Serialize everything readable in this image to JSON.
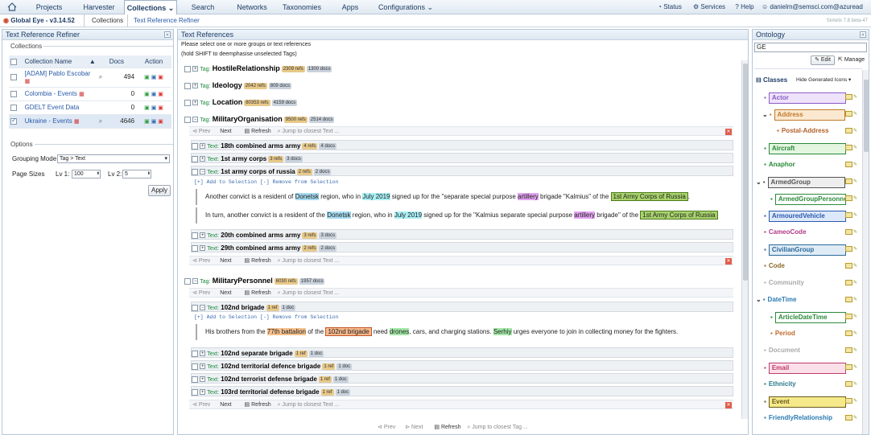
{
  "nav": {
    "home_icon": "home-icon",
    "items": [
      "Projects",
      "Harvester",
      "Collections",
      "Search",
      "Networks",
      "Taxonomies",
      "Apps",
      "Configurations"
    ],
    "right": {
      "status": "Status",
      "services": "Services",
      "help": "Help",
      "user": "danielm@semsci.com@azuread"
    }
  },
  "subbar": {
    "app_title": "Global Eye - v3.14.52",
    "crumb1": "Collections",
    "crumb2": "Text Reference Refiner",
    "build": "Sintelix 7.8.beta-47"
  },
  "left": {
    "title": "Text Reference Refiner",
    "collections_legend": "Collections",
    "columns": {
      "name": "Collection Name",
      "docs": "Docs",
      "action": "Action"
    },
    "rows": [
      {
        "name": "[ADAM] Pablo Escobar",
        "docs": "494",
        "checked": false
      },
      {
        "name": "Colombia - Events",
        "docs": "0",
        "checked": false
      },
      {
        "name": "GDELT Event Data",
        "docs": "0",
        "checked": false
      },
      {
        "name": "Ukraine - Events",
        "docs": "4646",
        "checked": true
      }
    ],
    "options_legend": "Options",
    "grouping_label": "Grouping Mode",
    "grouping_value": "Tag > Text",
    "page_sizes_label": "Page Sizes",
    "lv1_label": "Lv 1:",
    "lv1_value": "100",
    "lv2_label": "Lv 2:",
    "lv2_value": "5",
    "apply": "Apply"
  },
  "middle": {
    "title": "Text References",
    "hint1": "Please select one or more groups or text references",
    "hint2": "(hold SHIFT to deemphasise unselected Tags)",
    "tag_prefix": "Tag:",
    "text_prefix": "Text:",
    "tags": [
      {
        "name": "HostileRelationship",
        "refs": "2309 refs",
        "docs": "1300 docs"
      },
      {
        "name": "Ideology",
        "refs": "2042 refs",
        "docs": "809 docs"
      },
      {
        "name": "Location",
        "refs": "80353 refs",
        "docs": "4159 docs"
      },
      {
        "name": "MilitaryOrganisation",
        "refs": "9500 refs",
        "docs": "2514 docs"
      }
    ],
    "pager": {
      "prev": "Prev",
      "next": "Next",
      "refresh": "Refresh",
      "jump": "Jump to closest Text ...",
      "jump_tag": "Jump to closest Tag ..."
    },
    "mo_texts": [
      {
        "name": "18th combined arms army",
        "refs": "4 refs",
        "docs": "4 docs"
      },
      {
        "name": "1st army corps",
        "refs": "3 refs",
        "docs": "3 docs"
      },
      {
        "name": "1st army corps of russia",
        "refs": "2 refs",
        "docs": "2 docs"
      }
    ],
    "add_remove": "[+] Add to Selection [-] Remove from Selection",
    "snip1": {
      "a": "Another convict is a resident of ",
      "loc": "Donetsk",
      "b": " region, who in ",
      "dt": "July 2019",
      "c": " signed up for the \"separate special purpose ",
      "org": "artillery",
      "d": " brigade \"Kalmius\" of the ",
      "ag": "1st Army Corps of Russia",
      "e": "."
    },
    "snip2": {
      "a": "In turn, another convict is a resident of the ",
      "loc": "Donetsk",
      "b": " region, who in ",
      "dt": "July 2019",
      "c": " signed up for the \"Kalmius separate special purpose ",
      "org": "artillery",
      "d": " brigade\" of the ",
      "ag": "1st Army Corps of Russia"
    },
    "mo_texts2": [
      {
        "name": "20th combined arms army",
        "refs": "3 refs",
        "docs": "3 docs"
      },
      {
        "name": "29th combined arms army",
        "refs": "2 refs",
        "docs": "2 docs"
      }
    ],
    "tag_mp": {
      "name": "MilitaryPersonnel",
      "refs": "6030 refs",
      "docs": "1957 docs"
    },
    "mp_first": {
      "name": "102nd brigade",
      "refs": "1 ref",
      "docs": "1 doc"
    },
    "snip3": {
      "a": "His brothers from the ",
      "per": "77th battalion",
      "b": " of the ",
      "ag": "102nd brigade",
      "c": " need ",
      "dr": "drones",
      "d": ", cars, and charging stations. ",
      "sp": "Serhiy",
      "e": " urges everyone to join in collecting money for the fighters."
    },
    "mp_texts": [
      {
        "name": "102nd separate brigade",
        "refs": "1 ref",
        "docs": "1 doc"
      },
      {
        "name": "102nd territorial defence brigade",
        "refs": "1 ref",
        "docs": "1 doc"
      },
      {
        "name": "102nd terrorist defense brigade",
        "refs": "1 ref",
        "docs": "1 doc"
      },
      {
        "name": "103rd territorial defense brigade",
        "refs": "1 ref",
        "docs": "1 doc"
      }
    ]
  },
  "right": {
    "title": "Ontology",
    "search_value": "GE",
    "edit": "Edit",
    "manage": "Manage",
    "classes": "Classes",
    "hide_generated": "Hide Generated Icons",
    "items": [
      {
        "label": "Actor",
        "color": "#8a5cc8",
        "bg": "#efe3fb"
      },
      {
        "label": "Address",
        "color": "#c07a2a",
        "bg": "#fbe8d0"
      },
      {
        "label": "Postal-Address",
        "color": "#b0602a",
        "bg": ""
      },
      {
        "label": "Aircraft",
        "color": "#2a8a3a",
        "bg": "#e4f6e0"
      },
      {
        "label": "Anaphor",
        "color": "#2a8a3a",
        "bg": ""
      },
      {
        "label": "ArmedGroup",
        "color": "#555",
        "bg": "#eeeeee"
      },
      {
        "label": "ArmedGroupPersonnel",
        "color": "#2a8a3a",
        "bg": ""
      },
      {
        "label": "ArmouredVehicle",
        "color": "#2a5ab0",
        "bg": "#dde8fa"
      },
      {
        "label": "CameoCode",
        "color": "#b03a8a",
        "bg": ""
      },
      {
        "label": "CivilianGroup",
        "color": "#2a6a9a",
        "bg": "#e0ecf5"
      },
      {
        "label": "Code",
        "color": "#8a6a2a",
        "bg": ""
      },
      {
        "label": "Community",
        "color": "#aaa",
        "bg": ""
      },
      {
        "label": "DateTime",
        "color": "#2a7ab0",
        "bg": "#e0f0fb"
      },
      {
        "label": "ArticleDateTime",
        "color": "#2a8a3a",
        "bg": ""
      },
      {
        "label": "Period",
        "color": "#c06a2a",
        "bg": ""
      },
      {
        "label": "Document",
        "color": "#aaa",
        "bg": ""
      },
      {
        "label": "Email",
        "color": "#c03a6a",
        "bg": "#fbe0ea"
      },
      {
        "label": "Ethnicity",
        "color": "#2a7a8a",
        "bg": ""
      },
      {
        "label": "Event",
        "color": "#6a5a1a",
        "bg": "#f5e98a"
      },
      {
        "label": "FriendlyRelationship",
        "color": "#2a7ab0",
        "bg": ""
      }
    ]
  }
}
